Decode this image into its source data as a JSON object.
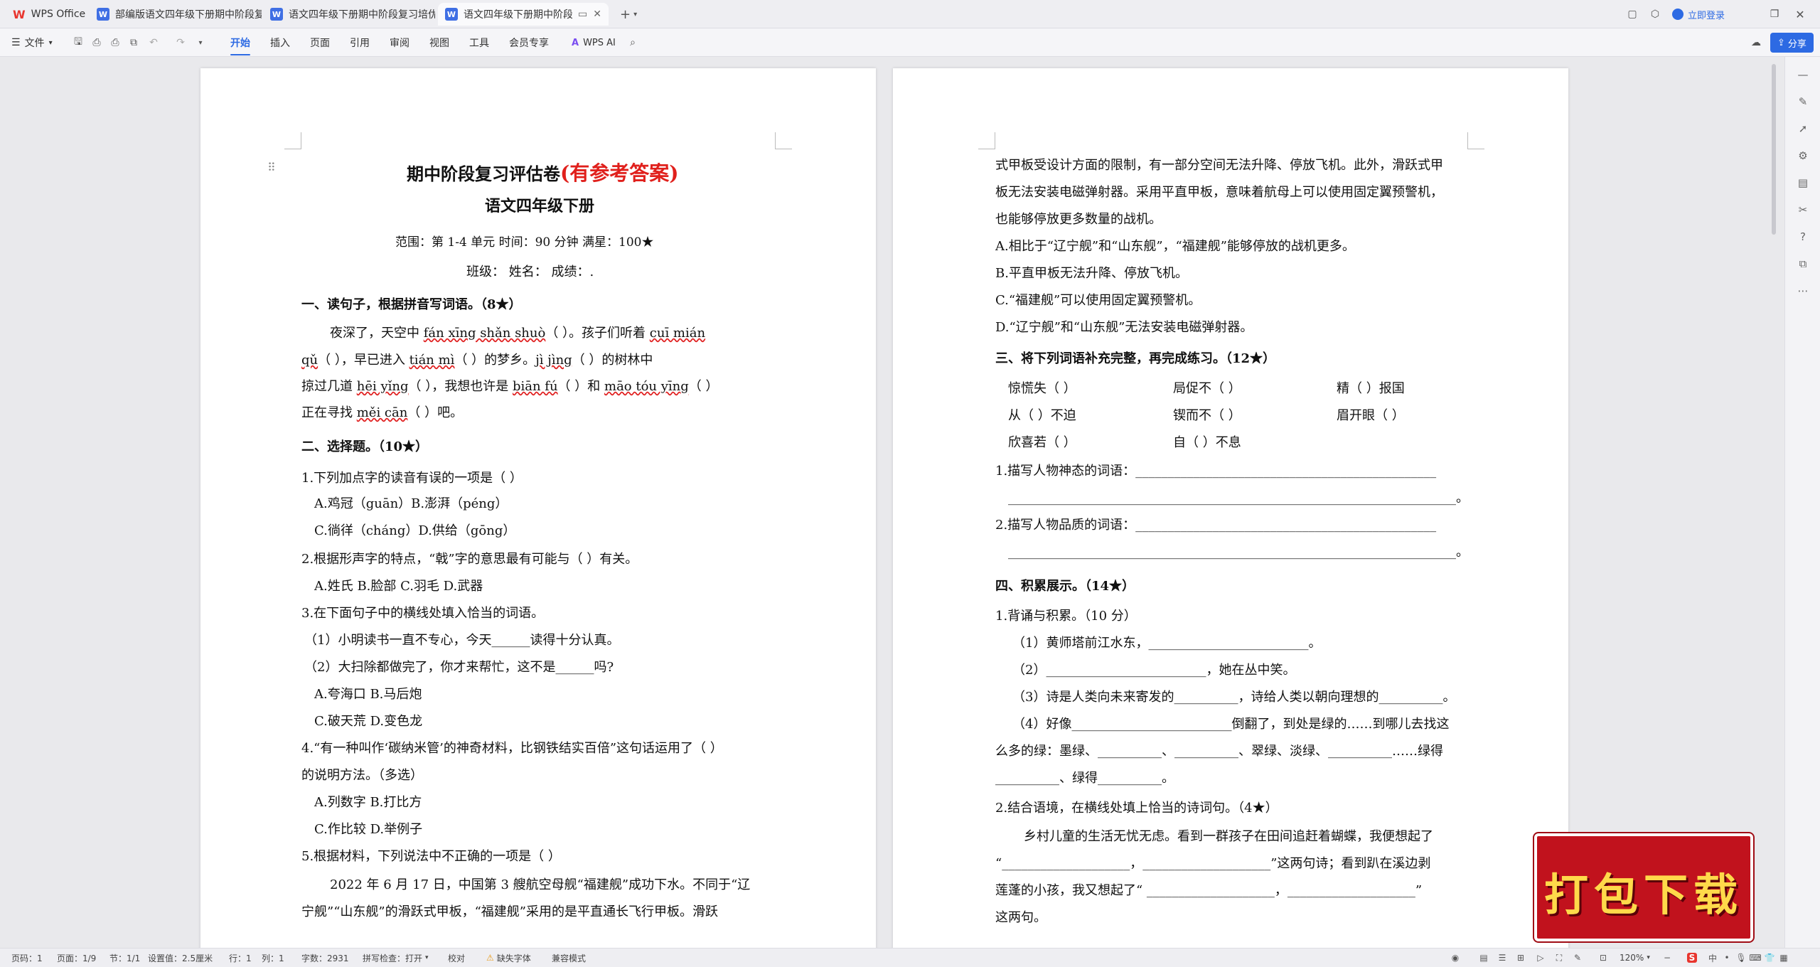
{
  "tabs": [
    {
      "label": "WPS Office"
    },
    {
      "label": "部编版语文四年级下册期中阶段复习评…"
    },
    {
      "label": "语文四年级下册期中阶段复习培优卷"
    },
    {
      "label": "语文四年级下册期中阶段复习…"
    }
  ],
  "titlebar": {
    "login": "立即登录"
  },
  "ribbon": {
    "file": "文件",
    "menus": [
      "开始",
      "插入",
      "页面",
      "引用",
      "审阅",
      "视图",
      "工具",
      "会员专享"
    ],
    "wpsai": "WPS AI",
    "share": "分享"
  },
  "page1": {
    "title_main": "期中阶段复习评估卷",
    "title_red": "(有参考答案)",
    "subtitle": "语文四年级下册",
    "scope": "范围：第 1-4 单元  时间：90 分钟   满星：100★",
    "info": "班级：  姓名：  成绩：.",
    "s1": "一、读句子，根据拼音写词语。（8★）",
    "s1_l1a": "夜深了，天空中 ",
    "s1_py1": "fán xīng shǎn shuò",
    "s1_l1b": "（          ）。孩子们听着 ",
    "s1_py2": "cuī mián",
    "s1_py3": "qǔ",
    "s1_l2a": "（          ），早已进入 ",
    "s1_py4": "tián mì",
    "s1_l2b": "（     ）的梦乡。",
    "s1_py5": "jì jìng",
    "s1_l2c": "（       ）的树林中",
    "s1_l3a": "掠过几道 ",
    "s1_py6": "hēi yǐng",
    "s1_l3b": "（      ），我想也许是 ",
    "s1_py7": "biān fú",
    "s1_l3c": "（     ）和 ",
    "s1_py8": "māo tóu yīng",
    "s1_l3d": "（          ）",
    "s1_l4a": "正在寻找 ",
    "s1_py9": "měi cān",
    "s1_l4b": "（      ）吧。",
    "s2": "二、选择题。（10★）",
    "q1": "1.下列加点字的读音有误的一项是（     ）",
    "q1a": "A.鸡冠（guān）B.澎湃（péng）",
    "q1c": "C.徜徉（cháng）D.供给（gōng）",
    "q2": "2.根据形声字的特点，“戟”字的意思最有可能与（      ）有关。",
    "q2a": "A.姓氏 B.脸部 C.羽毛 D.武器",
    "q3": "3.在下面句子中的横线处填入恰当的词语。",
    "q3_1": "（1）小明读书一直不专心，今天______读得十分认真。",
    "q3_2": "（2）大扫除都做完了，你才来帮忙，这不是______吗?",
    "q3a": "A.夸海口 B.马后炮",
    "q3c": "C.破天荒 D.变色龙",
    "q4": "4.“有一种叫作‘碳纳米管’的神奇材料，比钢铁结实百倍”这句话运用了（      ）",
    "q4b": "的说明方法。（多选）",
    "q4a": "A.列数字 B.打比方",
    "q4c": "C.作比较 D.举例子",
    "q5": "5.根据材料，下列说法中不正确的一项是（      ）",
    "q5_p1": "2022 年 6 月 17 日，中国第 3 艘航空母舰“福建舰”成功下水。不同于“辽",
    "q5_p2": "宁舰”“山东舰”的滑跃式甲板，“福建舰”采用的是平直通长飞行甲板。滑跃"
  },
  "page2": {
    "p1": "式甲板受设计方面的限制，有一部分空间无法升降、停放飞机。此外，滑跃式甲",
    "p2": "板无法安装电磁弹射器。采用平直甲板，意味着航母上可以使用固定翼预警机，",
    "p3": "也能够停放更多数量的战机。",
    "oa": "A.相比于“辽宁舰”和“山东舰”，“福建舰”能够停放的战机更多。",
    "ob": "B.平直甲板无法升降、停放飞机。",
    "oc": "C.“福建舰”可以使用固定翼预警机。",
    "od": "D.“辽宁舰”和“山东舰”无法安装电磁弹射器。",
    "s3": "三、将下列词语补充完整，再完成练习。（12★）",
    "w1": "惊慌失（     ）",
    "w2": "局促不（     ）",
    "w3": "精（     ）报国",
    "w4": "从（     ）不迫",
    "w5": "锲而不（     ）",
    "w6": "眉开眼（     ）",
    "w7": "欣喜若（     ）",
    "w8": "自（     ）不息",
    "d1": "1.描写人物神态的词语：_______________________________________________",
    "d1b": "______________________________________________________________________。",
    "d2": "2.描写人物品质的词语：_______________________________________________",
    "d2b": "______________________________________________________________________。",
    "s4": "四、积累展示。（14★）",
    "r1": "1.背诵与积累。（10 分）",
    "r1_1": "（1）黄师塔前江水东，_________________________。",
    "r1_2": "（2）_________________________，她在丛中笑。",
    "r1_3": "（3）诗是人类向未来寄发的__________，诗给人类以朝向理想的__________。",
    "r1_4": "（4）好像_________________________倒翻了，到处是绿的……到哪儿去找这",
    "r1_5": "么多的绿：墨绿、__________、__________、翠绿、淡绿、__________……绿得",
    "r1_6": "__________、绿得__________。",
    "r2": "2.结合语境，在横线处填上恰当的诗词句。（4★）",
    "r2_1": "乡村儿童的生活无忧无虑。看到一群孩子在田间追赶着蝴蝶，我便想起了",
    "r2_2": "“____________________，____________________”这两句诗；看到趴在溪边剥",
    "r2_3": "莲蓬的小孩，我又想起了“ ____________________，____________________”",
    "r2_4": "这两句。"
  },
  "status": {
    "pagenum": "页码：1",
    "pages": "页面：1/9",
    "section": "节：1/1",
    "setting": "设置值：2.5厘米",
    "row": "行：1",
    "col": "列：1",
    "words": "字数：2931",
    "spell": "拼写检查：打开",
    "proof": "校对",
    "missingfont": "缺失字体",
    "compat": "兼容模式",
    "zoom": "120%"
  },
  "banner": {
    "text": "打包下载"
  },
  "colors": {
    "accent": "#2d6ae3",
    "red": "#e0201c",
    "banner": "#c1121d"
  }
}
